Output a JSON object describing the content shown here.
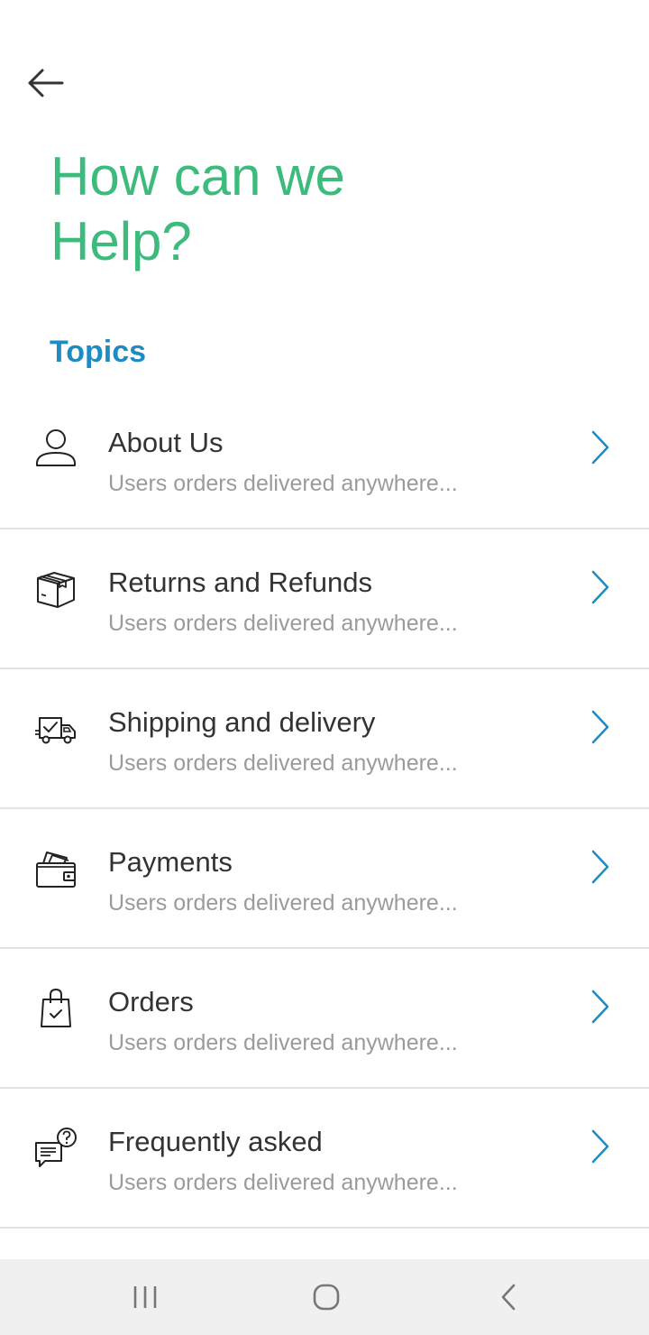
{
  "header": {
    "back_icon": "arrow-left-icon",
    "title": "How can we\nHelp?"
  },
  "topics": {
    "label": "Topics",
    "items": [
      {
        "icon": "user-icon",
        "title": "About Us",
        "subtitle": "Users orders delivered anywhere..."
      },
      {
        "icon": "box-icon",
        "title": "Returns and Refunds",
        "subtitle": "Users orders delivered anywhere..."
      },
      {
        "icon": "delivery-truck-icon",
        "title": "Shipping and delivery",
        "subtitle": "Users orders delivered anywhere..."
      },
      {
        "icon": "wallet-icon",
        "title": "Payments",
        "subtitle": "Users orders delivered anywhere..."
      },
      {
        "icon": "shopping-bag-icon",
        "title": "Orders",
        "subtitle": "Users orders delivered anywhere..."
      },
      {
        "icon": "faq-chat-icon",
        "title": "Frequently asked",
        "subtitle": "Users orders delivered anywhere..."
      }
    ]
  },
  "colors": {
    "title": "#3dbb7d",
    "accent": "#1e8bc3",
    "text": "#333333",
    "subtext": "#9b9b9b"
  },
  "system_nav": {
    "recent_icon": "recent-apps-icon",
    "home_icon": "home-icon",
    "back_icon": "back-chevron-icon"
  }
}
